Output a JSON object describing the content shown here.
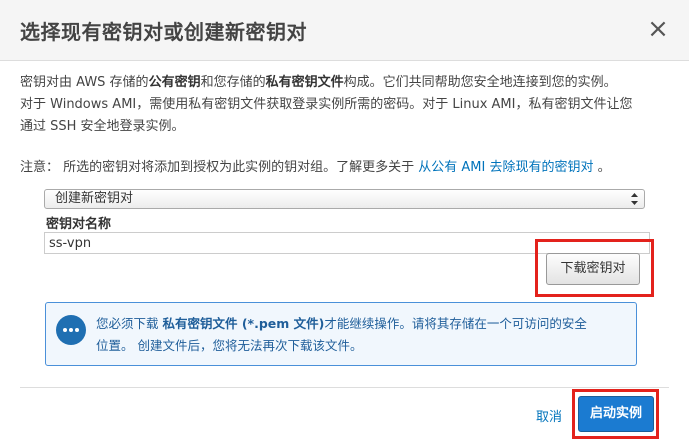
{
  "dialog": {
    "title": "选择现有密钥对或创建新密钥对",
    "close_glyph": "×"
  },
  "description": {
    "line1_a": "密钥对由 AWS 存储的",
    "line1_b": "公有密钥",
    "line1_c": "和您存储的",
    "line1_d": "私有密钥文件",
    "line1_e": "构成。它们共同帮助您安全地连接到您的实例。",
    "line2": "对于 Windows AMI，需使用私有密钥文件获取登录实例所需的密码。对于 Linux AMI，私有密钥文件让您",
    "line3": "通过 SSH 安全地登录实例。"
  },
  "note": {
    "prefix": "注意：  所选的密钥对将添加到授权为此实例的钥对组。了解更多关于 ",
    "link": "从公有 AMI 去除现有的密钥对",
    "suffix": " 。"
  },
  "form": {
    "select_value": "创建新密钥对",
    "name_label": "密钥对名称",
    "name_value": "ss-vpn",
    "download_label": "下载密钥对"
  },
  "alert": {
    "icon": "chat-bubble-icon",
    "a": "您必须下载 ",
    "b": "私有密钥文件 (*.pem 文件)",
    "c": "才能继续操作。请将其存储在一个可访问的安全",
    "line2": "位置。 创建文件后，您将无法再次下载该文件。"
  },
  "footer": {
    "cancel_label": "取消",
    "launch_label": "启动实例"
  },
  "colors": {
    "highlight": "#e3221c",
    "link": "#0073bb",
    "primary": "#1b7bd1",
    "alert_border": "#4a90d9"
  }
}
